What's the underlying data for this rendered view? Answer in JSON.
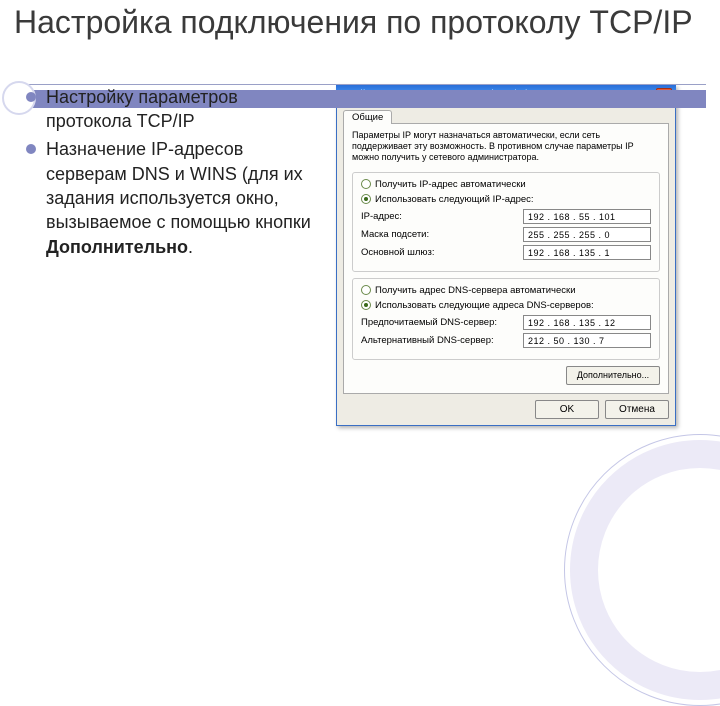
{
  "title": "Настройка подключения по протоколу TCP/IP",
  "bullets": {
    "item1": "Настройку параметров протокола TCP/IP",
    "item2_a": "Назначение IP-адресов серверам DNS и WINS (для их задания используется окно, вызываемое с помощью кнопки ",
    "item2_b": "Дополнительно",
    "item2_c": "."
  },
  "dialog": {
    "title": "Свойства: Протокол Интернета (TCP/IP)",
    "close": "×",
    "tab": "Общие",
    "hint": "Параметры IP могут назначаться автоматически, если сеть поддерживает эту возможность. В противном случае параметры IP можно получить у сетевого администратора.",
    "radio_auto_ip": "Получить IP-адрес автоматически",
    "radio_manual_ip": "Использовать следующий IP-адрес:",
    "lbl_ip": "IP-адрес:",
    "val_ip": "192 . 168 .  55 . 101",
    "lbl_mask": "Маска подсети:",
    "val_mask": "255 . 255 . 255 .   0",
    "lbl_gw": "Основной шлюз:",
    "val_gw": "192 . 168 . 135 .   1",
    "radio_auto_dns": "Получить адрес DNS-сервера автоматически",
    "radio_manual_dns": "Использовать следующие адреса DNS-серверов:",
    "lbl_dns1": "Предпочитаемый DNS-сервер:",
    "val_dns1": "192 . 168 . 135 .  12",
    "lbl_dns2": "Альтернативный DNS-сервер:",
    "val_dns2": "212 .  50 . 130 .   7",
    "advanced": "Дополнительно...",
    "ok": "OK",
    "cancel": "Отмена"
  }
}
